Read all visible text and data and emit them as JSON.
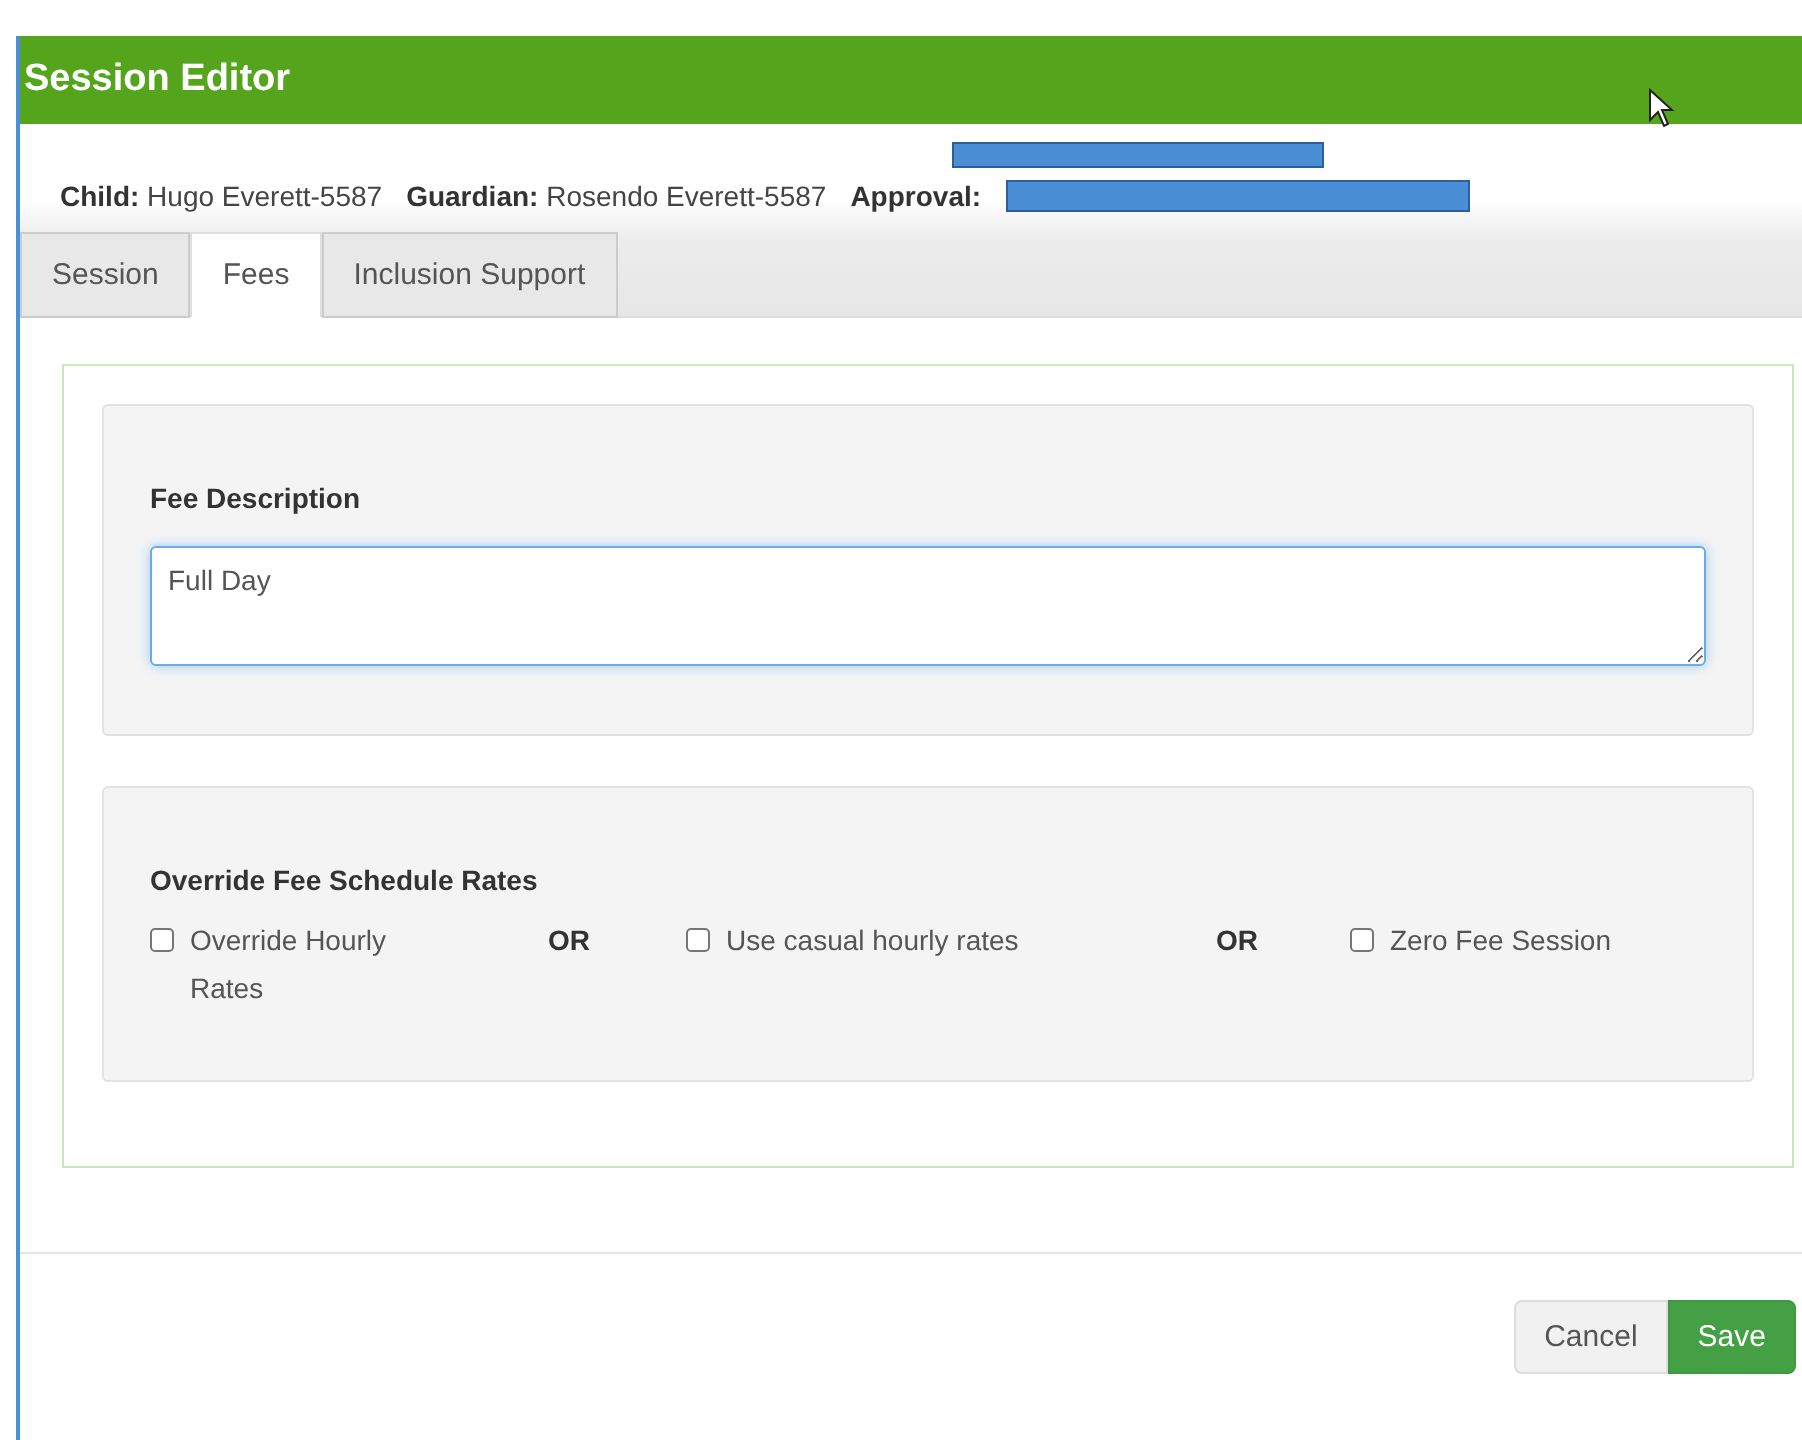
{
  "window": {
    "title": "Session Editor"
  },
  "info": [
    {
      "label": "Child:",
      "value": "Hugo Everett-5587"
    },
    {
      "label": "Guardian:",
      "value": "Rosendo Everett-5587"
    },
    {
      "label": "Approval:"
    }
  ],
  "tabs": [
    {
      "label": "Session",
      "selected": false
    },
    {
      "label": "Fees",
      "selected": true
    },
    {
      "label": "Inclusion Support",
      "selected": false
    }
  ],
  "fee_description": {
    "label": "Fee Description",
    "value": "Full Day"
  },
  "override": {
    "title": "Override Fee Schedule Rates",
    "separators": [
      "OR",
      "OR"
    ],
    "options": [
      {
        "label": "Override Hourly Rates",
        "checked": false
      },
      {
        "label": "Use casual hourly rates",
        "checked": false
      },
      {
        "label": "Zero Fee Session",
        "checked": false
      }
    ]
  },
  "buttons": [
    {
      "label": "Cancel",
      "kind": "secondary"
    },
    {
      "label": "Save",
      "kind": "primary"
    }
  ]
}
